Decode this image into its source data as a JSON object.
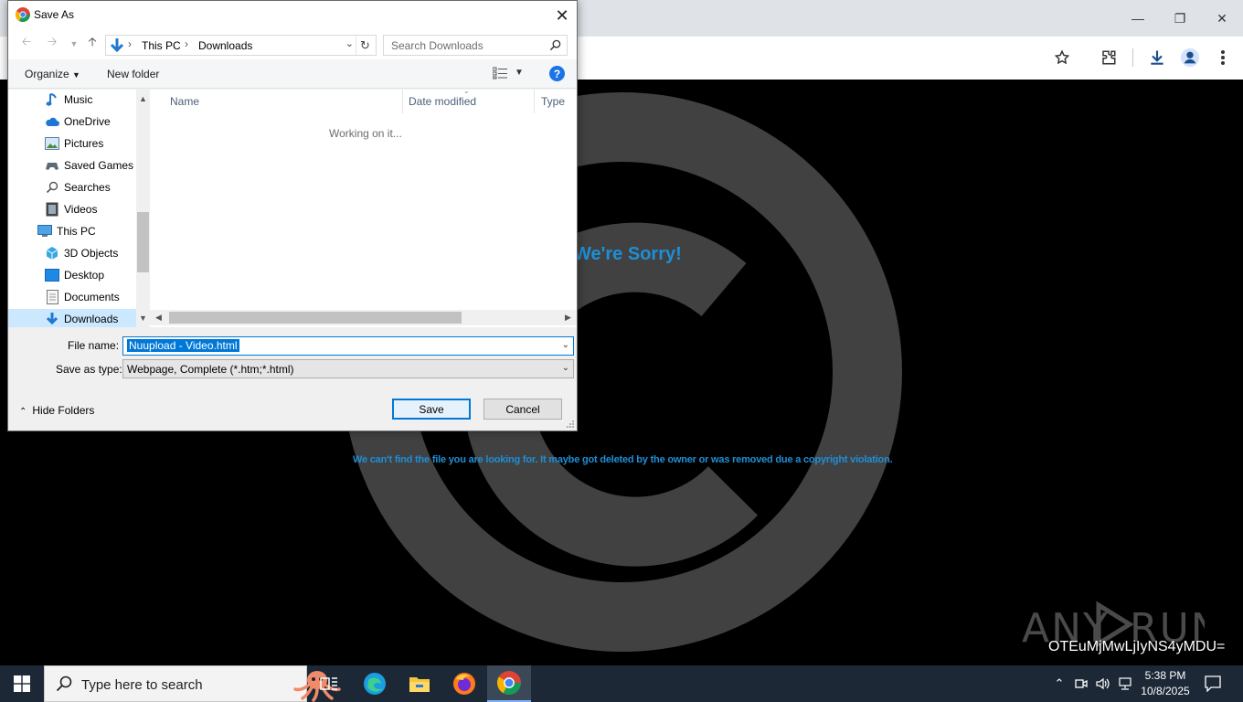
{
  "dialog": {
    "title": "Save As",
    "breadcrumb": [
      "This PC",
      "Downloads"
    ],
    "search_placeholder": "Search Downloads",
    "toolbar": {
      "organize": "Organize",
      "new_folder": "New folder"
    },
    "nav_tree": [
      {
        "label": "Music",
        "icon": "music-icon"
      },
      {
        "label": "OneDrive",
        "icon": "cloud-icon"
      },
      {
        "label": "Pictures",
        "icon": "pictures-icon"
      },
      {
        "label": "Saved Games",
        "icon": "saved-games-icon"
      },
      {
        "label": "Searches",
        "icon": "searches-icon"
      },
      {
        "label": "Videos",
        "icon": "videos-icon"
      },
      {
        "label": "This PC",
        "icon": "computer-icon"
      },
      {
        "label": "3D Objects",
        "icon": "3d-objects-icon"
      },
      {
        "label": "Desktop",
        "icon": "desktop-icon"
      },
      {
        "label": "Documents",
        "icon": "documents-icon"
      },
      {
        "label": "Downloads",
        "icon": "downloads-icon",
        "selected": true
      }
    ],
    "columns": [
      "Name",
      "Date modified",
      "Type"
    ],
    "status": "Working on it...",
    "file_name_label": "File name:",
    "file_name_value": "Nuupload - Video.html",
    "save_type_label": "Save as type:",
    "save_type_value": "Webpage, Complete (*.htm;*.html)",
    "hide_folders": "Hide Folders",
    "save_button": "Save",
    "cancel_button": "Cancel"
  },
  "page": {
    "heading": "We're Sorry!",
    "message": "We can't find the file you are looking for. It maybe got deleted by the owner or was removed due a copyright violation.",
    "accent_color": "#1e8fd6"
  },
  "watermark": {
    "logo_text": "ANY RUN",
    "id_text": "OTEuMjMwLjIyNS4yMDU="
  },
  "taskbar": {
    "search_placeholder": "Type here to search",
    "time": "5:38 PM",
    "date": "10/8/2025"
  }
}
